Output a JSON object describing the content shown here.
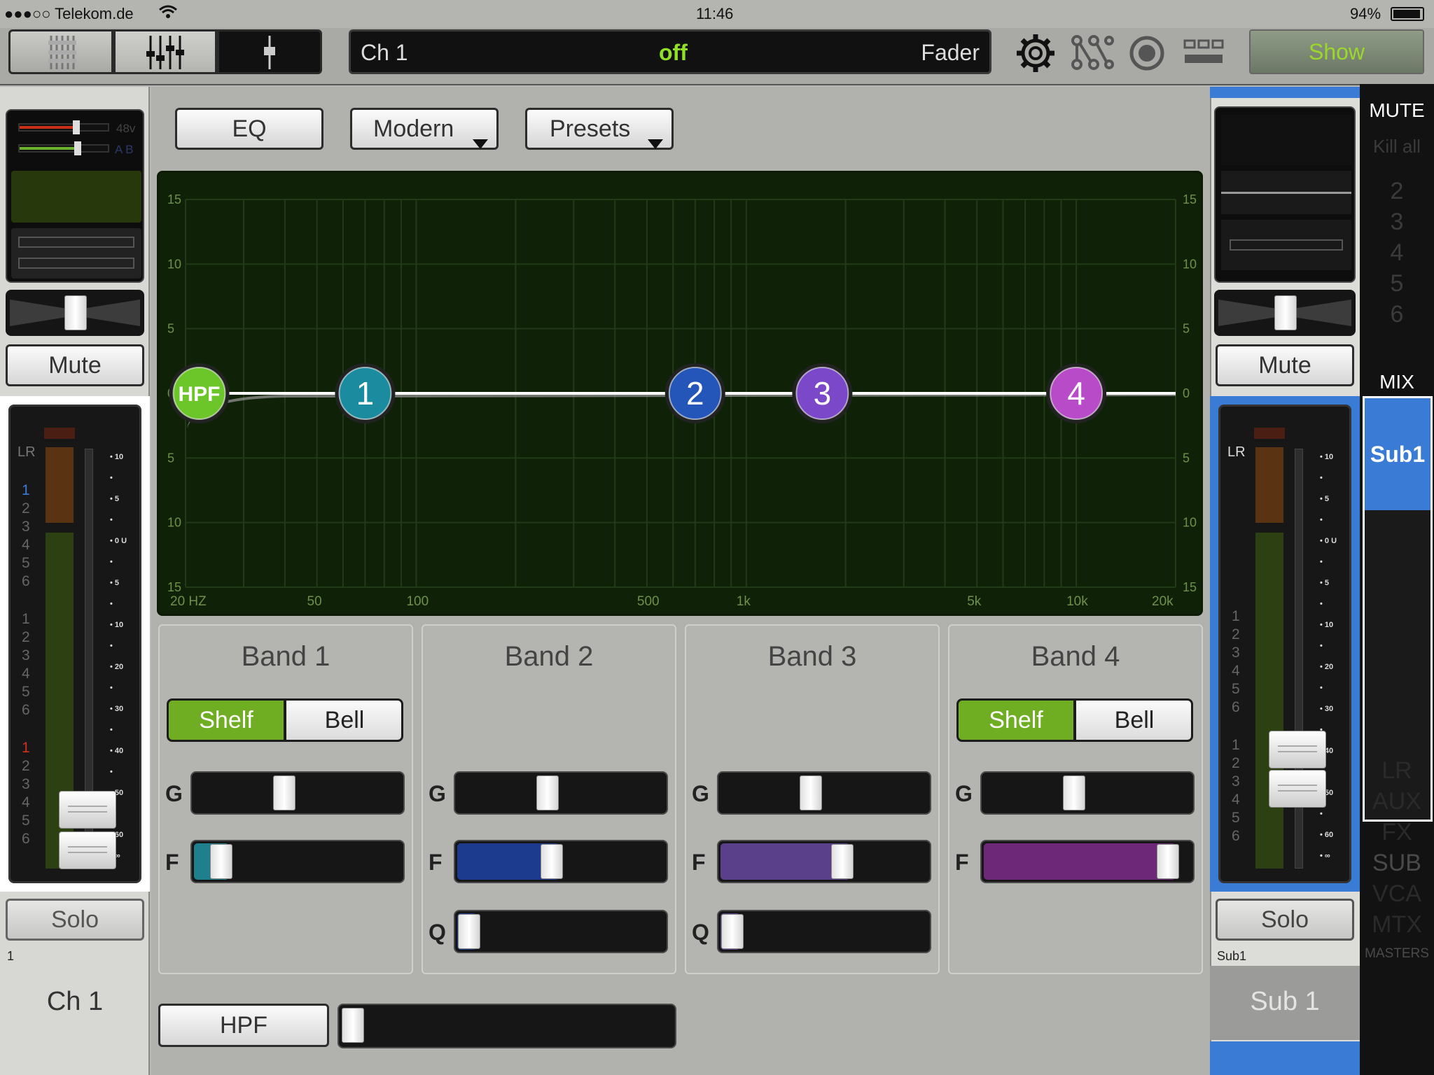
{
  "status": {
    "carrier": "●●●○○ Telekom.de",
    "time": "11:46",
    "battery": "94%"
  },
  "channel_bar": {
    "channel": "Ch 1",
    "state": "off",
    "mode": "Fader"
  },
  "toolbar": {
    "show_label": "Show"
  },
  "eq_header": {
    "eq_label": "EQ",
    "mode_label": "Modern",
    "presets_label": "Presets"
  },
  "graph": {
    "y_labels": [
      "15",
      "10",
      "5",
      "0",
      "5",
      "10",
      "15"
    ],
    "x_labels": [
      "20 HZ",
      "50",
      "100",
      "500",
      "1k",
      "5k",
      "10k",
      "20k"
    ],
    "nodes": [
      {
        "label": "HPF",
        "color": "#6cc62a"
      },
      {
        "label": "1",
        "color": "#1b8ca0"
      },
      {
        "label": "2",
        "color": "#2455b8"
      },
      {
        "label": "3",
        "color": "#7a48c8"
      },
      {
        "label": "4",
        "color": "#b84cc8"
      }
    ]
  },
  "bands": [
    {
      "title": "Band 1",
      "shelf": "Shelf",
      "bell": "Bell",
      "g": "G",
      "f": "F",
      "gain": 0.5,
      "freq": 0.18,
      "fill": "#1f7f8c"
    },
    {
      "title": "Band 2",
      "g": "G",
      "f": "F",
      "q": "Q",
      "gain": 0.5,
      "freq": 0.52,
      "qv": 0.1,
      "fill": "#1c3a8e"
    },
    {
      "title": "Band 3",
      "g": "G",
      "f": "F",
      "q": "Q",
      "gain": 0.5,
      "freq": 0.66,
      "qv": 0.1,
      "fill": "#5a3f8a"
    },
    {
      "title": "Band 4",
      "shelf": "Shelf",
      "bell": "Bell",
      "g": "G",
      "f": "F",
      "gain": 0.5,
      "freq": 0.98,
      "fill": "#6e2878"
    }
  ],
  "hpf": {
    "label": "HPF",
    "value": 0.0
  },
  "left_strip": {
    "phantom": "48v",
    "ab": "A B",
    "mute": "Mute",
    "solo": "Solo",
    "lr": "LR",
    "num": "1",
    "name": "Ch 1",
    "groups": [
      "1",
      "2",
      "3",
      "4",
      "5",
      "6"
    ]
  },
  "right_strip": {
    "mute": "Mute",
    "solo": "Solo",
    "lr": "LR",
    "sub_small": "Sub1",
    "name": "Sub 1",
    "groups": [
      "1",
      "2",
      "3",
      "4",
      "5",
      "6"
    ]
  },
  "meter_scale": [
    "10",
    "5",
    "0 U",
    "5",
    "10",
    "20",
    "30",
    "40",
    "50",
    "60",
    "∞"
  ],
  "mix_column": {
    "mute_title": "MUTE",
    "kill_all": "Kill all",
    "mute_groups": [
      "2",
      "3",
      "4",
      "5",
      "6"
    ],
    "mix_title": "MIX",
    "selected": "Sub1",
    "types": [
      "LR",
      "AUX",
      "FX",
      "SUB",
      "VCA",
      "MTX"
    ],
    "masters": "MASTERS"
  }
}
